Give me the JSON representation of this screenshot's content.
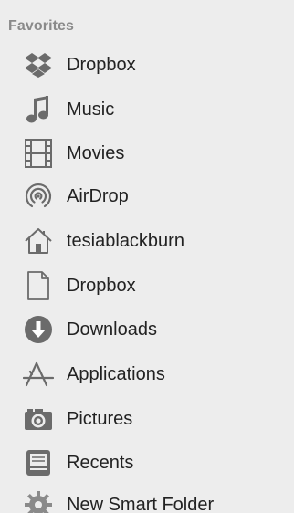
{
  "sidebar": {
    "section_title": "Favorites",
    "items": [
      {
        "label": "Dropbox",
        "icon": "dropbox-icon"
      },
      {
        "label": "Music",
        "icon": "music-note-icon"
      },
      {
        "label": "Movies",
        "icon": "film-strip-icon"
      },
      {
        "label": "AirDrop",
        "icon": "airdrop-icon"
      },
      {
        "label": "tesiablackburn",
        "icon": "home-icon"
      },
      {
        "label": "Dropbox",
        "icon": "document-icon"
      },
      {
        "label": "Downloads",
        "icon": "download-arrow-icon"
      },
      {
        "label": "Applications",
        "icon": "applications-icon"
      },
      {
        "label": "Pictures",
        "icon": "camera-icon"
      },
      {
        "label": "Recents",
        "icon": "recents-tray-icon"
      },
      {
        "label": "New Smart Folder",
        "icon": "gear-icon"
      }
    ]
  },
  "colors": {
    "background": "#ededed",
    "section_title": "#8a8a8a",
    "label": "#222222",
    "icon": "#6b6b6b"
  }
}
